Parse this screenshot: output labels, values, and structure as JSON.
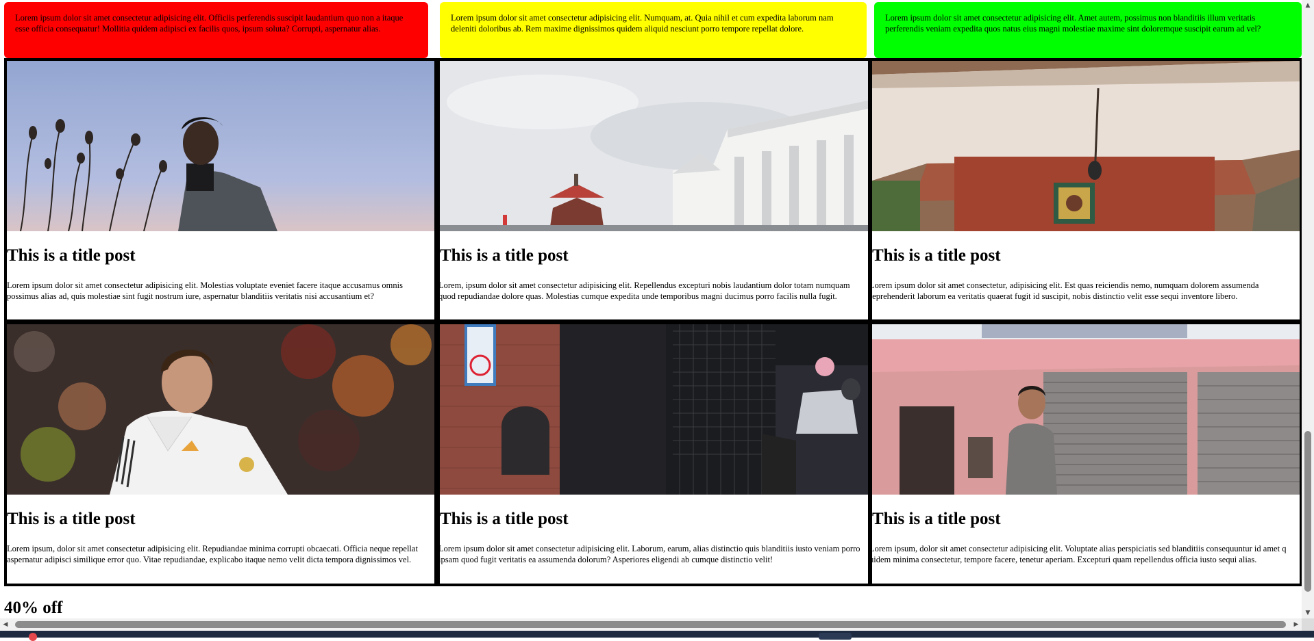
{
  "notes": [
    {
      "text": "Lorem ipsum dolor sit amet consectetur adipisicing elit. Officiis perferendis suscipit laudantium quo non a itaque esse officia consequatur! Mollitia quidem adipisci ex facilis quos, ipsum soluta? Corrupti, aspernatur alias.",
      "color": "#ff0000"
    },
    {
      "text": "Lorem ipsum dolor sit amet consectetur adipisicing elit. Numquam, at. Quia nihil et cum expedita laborum nam deleniti doloribus ab. Rem maxime dignissimos quidem aliquid nesciunt porro tempore repellat dolore.",
      "color": "#ffff00"
    },
    {
      "text": "Lorem ipsum dolor sit amet consectetur adipisicing elit. Amet autem, possimus non blanditiis illum veritatis perferendis veniam expedita quos natus eius magni molestiae maxime sint doloremque suscipit earum ad vel?",
      "color": "#00ff00"
    }
  ],
  "cards": [
    {
      "title": "This is a title post",
      "body": "Lorem ipsum dolor sit amet consectetur adipisicing elit. Molestias voluptate eveniet facere itaque accusamus omnis possimus alias ad, quis molestiae sint fugit nostrum iure, aspernatur blanditiis veritatis nisi accusantium et?"
    },
    {
      "title": "This is a title post",
      "body": "Lorem, ipsum dolor sit amet consectetur adipisicing elit. Repellendus excepturi nobis laudantium dolor totam numquam quod repudiandae dolore quas. Molestias cumque expedita unde temporibus magni ducimus porro facilis nulla fugit."
    },
    {
      "title": "This is a title post",
      "body": "Lorem ipsum dolor sit amet consectetur, adipisicing elit. Est quas reiciendis nemo, numquam dolorem assumenda reprehenderit laborum ea veritatis quaerat fugit id suscipit, nobis distinctio velit esse sequi inventore libero."
    },
    {
      "title": "This is a title post",
      "body": "Lorem ipsum, dolor sit amet consectetur adipisicing elit. Repudiandae minima corrupti obcaecati. Officia neque repellat aspernatur adipisci similique error quo. Vitae repudiandae, explicabo itaque nemo velit dicta tempora dignissimos vel."
    },
    {
      "title": "This is a title post",
      "body": "Lorem ipsum dolor sit amet consectetur adipisicing elit. Laborum, earum, alias distinctio quis blanditiis iusto veniam porro ipsam quod fugit veritatis ea assumenda dolorum? Asperiores eligendi ab cumque distinctio velit!"
    },
    {
      "title": "This is a title post",
      "body": "Lorem ipsum, dolor sit amet consectetur adipisicing elit. Voluptate alias perspiciatis sed blanditiis consequuntur id amet q uidem minima consectetur, tempore facere, tenetur aperiam. Excepturi quam repellendus officia iusto sequi alias."
    }
  ],
  "offer": "40% off",
  "icons": {
    "scroll_up": "scroll-up-arrow-icon",
    "scroll_down": "scroll-down-arrow-icon",
    "scroll_left": "scroll-left-arrow-icon",
    "scroll_right": "scroll-right-arrow-icon"
  }
}
